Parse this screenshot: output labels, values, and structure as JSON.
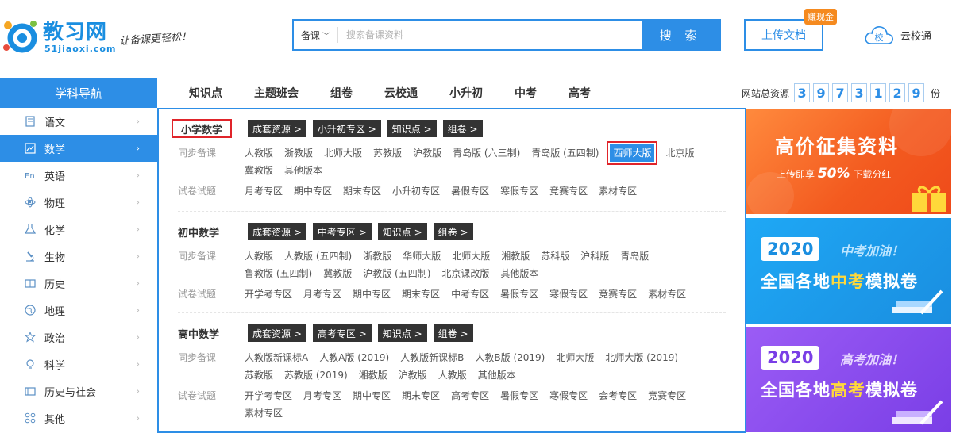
{
  "header": {
    "logo_title": "教习网",
    "logo_sub": "51jiaoxi.com",
    "slogan": "让备课更轻松！",
    "search": {
      "category": "备课",
      "placeholder": "搜索备课资料",
      "button": "搜 索"
    },
    "upload": {
      "label": "上传文档",
      "badge": "赚现金"
    },
    "yxt": {
      "icon_text": "校",
      "label": "云校通"
    }
  },
  "nav": {
    "left_title": "学科导航",
    "links": [
      "知识点",
      "主题班会",
      "组卷",
      "云校通",
      "小升初",
      "中考",
      "高考"
    ],
    "total_label": "网站总资源",
    "digits": [
      "3",
      "9",
      "7",
      "3",
      "1",
      "2",
      "9"
    ],
    "total_unit": "份"
  },
  "sidebar": {
    "items": [
      {
        "label": "语文",
        "icon": "book-icon",
        "active": false
      },
      {
        "label": "数学",
        "icon": "chart-icon",
        "active": true
      },
      {
        "label": "英语",
        "icon": "en-icon",
        "active": false
      },
      {
        "label": "物理",
        "icon": "atom-icon",
        "active": false
      },
      {
        "label": "化学",
        "icon": "flask-icon",
        "active": false
      },
      {
        "label": "生物",
        "icon": "microscope-icon",
        "active": false
      },
      {
        "label": "历史",
        "icon": "history-book-icon",
        "active": false
      },
      {
        "label": "地理",
        "icon": "globe-icon",
        "active": false
      },
      {
        "label": "政治",
        "icon": "politics-icon",
        "active": false
      },
      {
        "label": "科学",
        "icon": "bulb-icon",
        "active": false
      },
      {
        "label": "历史与社会",
        "icon": "society-icon",
        "active": false
      },
      {
        "label": "其他",
        "icon": "grid-icon",
        "active": false
      }
    ]
  },
  "sections": [
    {
      "title": "小学数学",
      "tags": [
        "成套资源 >",
        "小升初专区 >",
        "知识点 >",
        "组卷 >"
      ],
      "sync_label": "同步备课",
      "sync": [
        "人教版",
        "浙教版",
        "北师大版",
        "苏教版",
        "沪教版",
        "青岛版 (六三制)",
        "青岛版 (五四制)",
        "西师大版",
        "北京版",
        "冀教版",
        "其他版本"
      ],
      "test_label": "试卷试题",
      "tests": [
        "月考专区",
        "期中专区",
        "期末专区",
        "小升初专区",
        "暑假专区",
        "寒假专区",
        "竞赛专区",
        "素材专区"
      ]
    },
    {
      "title": "初中数学",
      "tags": [
        "成套资源 >",
        "中考专区 >",
        "知识点 >",
        "组卷 >"
      ],
      "sync_label": "同步备课",
      "sync": [
        "人教版",
        "人教版 (五四制)",
        "浙教版",
        "华师大版",
        "北师大版",
        "湘教版",
        "苏科版",
        "沪科版",
        "青岛版",
        "鲁教版 (五四制)",
        "冀教版",
        "沪教版 (五四制)",
        "北京课改版",
        "其他版本"
      ],
      "test_label": "试卷试题",
      "tests": [
        "开学考专区",
        "月考专区",
        "期中专区",
        "期末专区",
        "中考专区",
        "暑假专区",
        "寒假专区",
        "竞赛专区",
        "素材专区"
      ]
    },
    {
      "title": "高中数学",
      "tags": [
        "成套资源 >",
        "高考专区 >",
        "知识点 >",
        "组卷 >"
      ],
      "sync_label": "同步备课",
      "sync": [
        "人教版新课标A",
        "人教A版 (2019)",
        "人教版新课标B",
        "人教B版 (2019)",
        "北师大版",
        "北师大版 (2019)",
        "苏教版",
        "苏教版 (2019)",
        "湘教版",
        "沪教版",
        "人教版",
        "其他版本"
      ],
      "test_label": "试卷试题",
      "tests": [
        "开学考专区",
        "月考专区",
        "期中专区",
        "期末专区",
        "高考专区",
        "暑假专区",
        "寒假专区",
        "会考专区",
        "竞赛专区",
        "素材专区"
      ]
    }
  ],
  "banners": {
    "b1": {
      "title": "高价征集资料",
      "sub_pre": "上传即享",
      "sub_num": "50%",
      "sub_post": "下载分红"
    },
    "b2": {
      "year": "2020",
      "slogan": "中考加油！",
      "main_pre": "全国各地",
      "main_hl": "中考",
      "main_post": "模拟卷"
    },
    "b3": {
      "year": "2020",
      "slogan": "高考加油！",
      "main_pre": "全国各地",
      "main_hl": "高考",
      "main_post": "模拟卷"
    }
  },
  "colors": {
    "brand": "#2d8ee6",
    "highlight_border": "#e0242a",
    "tag_bg": "#333333",
    "badge": "#f58a1f"
  }
}
